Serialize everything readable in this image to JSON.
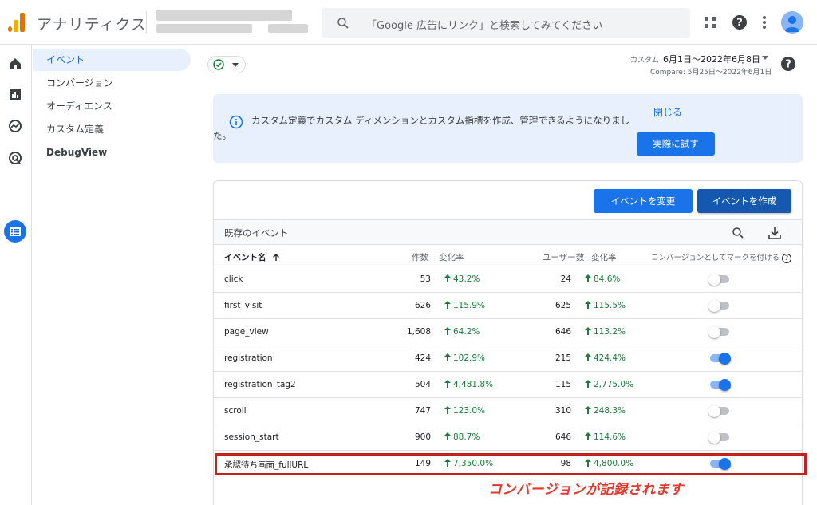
{
  "app": {
    "title": "アナリティクス",
    "search_placeholder": "「Google 広告にリンク」と検索してみてください"
  },
  "subnav": {
    "items": [
      {
        "label": "イベント",
        "active": true
      },
      {
        "label": "コンバージョン"
      },
      {
        "label": "オーディエンス"
      },
      {
        "label": "カスタム定義"
      },
      {
        "label": "DebugView"
      }
    ]
  },
  "date": {
    "label": "カスタム",
    "range": "6月1日〜2022年6月8日",
    "compare": "Compare: 5月25日〜2022年6月1日"
  },
  "banner": {
    "text": "カスタム定義でカスタム ディメンションとカスタム指標を作成、管理できるようになりました。",
    "close_label": "閉じる",
    "try_label": "実際に試す"
  },
  "card": {
    "modify_label": "イベントを変更",
    "create_label": "イベントを作成",
    "title": "既存のイベント"
  },
  "table": {
    "headers": {
      "name": "イベント名",
      "count": "件数",
      "change1": "変化率",
      "users": "ユーザー数",
      "change2": "変化率",
      "conversion": "コンバージョンとしてマークを付ける"
    },
    "rows": [
      {
        "name": "click",
        "count": "53",
        "change1": "43.2%",
        "users": "24",
        "change2": "84.6%",
        "conversion": false
      },
      {
        "name": "first_visit",
        "count": "626",
        "change1": "115.9%",
        "users": "625",
        "change2": "115.5%",
        "conversion": false
      },
      {
        "name": "page_view",
        "count": "1,608",
        "change1": "64.2%",
        "users": "646",
        "change2": "113.2%",
        "conversion": false
      },
      {
        "name": "registration",
        "count": "424",
        "change1": "102.9%",
        "users": "215",
        "change2": "424.4%",
        "conversion": true
      },
      {
        "name": "registration_tag2",
        "count": "504",
        "change1": "4,481.8%",
        "users": "115",
        "change2": "2,775.0%",
        "conversion": true
      },
      {
        "name": "scroll",
        "count": "747",
        "change1": "123.0%",
        "users": "310",
        "change2": "248.3%",
        "conversion": false
      },
      {
        "name": "session_start",
        "count": "900",
        "change1": "88.7%",
        "users": "646",
        "change2": "114.6%",
        "conversion": false
      },
      {
        "name": "承認待ち画面_fullURL",
        "count": "149",
        "change1": "7,350.0%",
        "users": "98",
        "change2": "4,800.0%",
        "conversion": true
      }
    ]
  },
  "annotation": "コンバージョンが記録されます",
  "colors": {
    "accent": "#1a73e8",
    "positive": "#188038",
    "highlight": "#c5221f"
  }
}
